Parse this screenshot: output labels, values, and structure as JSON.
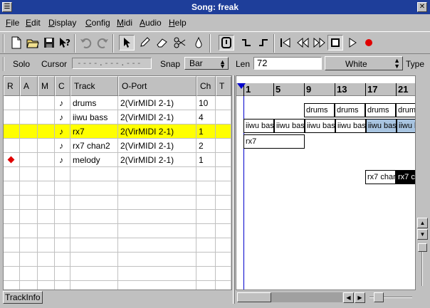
{
  "window": {
    "title": "Song: freak"
  },
  "menu": {
    "items": [
      {
        "label": "File",
        "key": "F",
        "rest": "ile"
      },
      {
        "label": "Edit",
        "key": "E",
        "rest": "dit"
      },
      {
        "label": "Display",
        "key": "D",
        "rest": "isplay"
      },
      {
        "label": "Config",
        "key": "C",
        "rest": "onfig"
      },
      {
        "label": "Midi",
        "key": "M",
        "rest": "idi"
      },
      {
        "label": "Audio",
        "key": "A",
        "rest": "udio"
      },
      {
        "label": "Help",
        "key": "H",
        "rest": "elp"
      }
    ]
  },
  "toolbar": {
    "icons": [
      "new-file-icon",
      "open-folder-icon",
      "save-icon",
      "whats-this-icon",
      "undo-icon",
      "redo-icon",
      "pointer-icon",
      "pencil-icon",
      "eraser-icon",
      "scissors-icon",
      "glue-icon",
      "follow-page-icon",
      "follow-cont-icon",
      "follow-none-icon",
      "rewind-start-icon",
      "rewind-icon",
      "fast-forward-icon",
      "stop-icon",
      "play-icon",
      "record-icon"
    ]
  },
  "controls": {
    "solo_label": "Solo",
    "cursor_label": "Cursor",
    "cursor_value": "----.---.---",
    "snap_label": "Snap",
    "snap_value": "Bar",
    "len_label": "Len",
    "len_value": "72",
    "color_value": "White",
    "type_label": "Type"
  },
  "tracklist": {
    "columns": [
      "R",
      "A",
      "M",
      "C",
      "Track",
      "O-Port",
      "Ch",
      "T"
    ],
    "rows": [
      {
        "record": false,
        "icon": "♪",
        "name": "drums",
        "port": "2(VirMIDI 2-1)",
        "ch": "10",
        "selected": false
      },
      {
        "record": false,
        "icon": "♪",
        "name": "iiwu bass",
        "port": "2(VirMIDI 2-1)",
        "ch": "4",
        "selected": false
      },
      {
        "record": false,
        "icon": "♪",
        "name": "rx7",
        "port": "2(VirMIDI 2-1)",
        "ch": "1",
        "selected": true
      },
      {
        "record": false,
        "icon": "♪",
        "name": "rx7 chan2",
        "port": "2(VirMIDI 2-1)",
        "ch": "2",
        "selected": false
      },
      {
        "record": true,
        "icon": "♪",
        "name": "melody",
        "port": "2(VirMIDI 2-1)",
        "ch": "1",
        "selected": false
      }
    ]
  },
  "trackinfo_label": "TrackInfo",
  "ruler": {
    "marks": [
      "1",
      "5",
      "9",
      "13",
      "17",
      "21"
    ]
  },
  "parts": {
    "drums": [
      "drums",
      "drums",
      "drums",
      "drums"
    ],
    "bass": [
      "iiwu bas",
      "iiwu bas",
      "iiwu bas",
      "iiwu bas",
      "iiwu bas",
      "iiwu b"
    ],
    "rx7": "rx7",
    "rx7chan2": [
      "rx7 char",
      "rx7 c"
    ]
  },
  "colors": {
    "selected_row": "#ffff00",
    "title_bar": "#1e3e9a",
    "record_dot": "#e00000"
  }
}
